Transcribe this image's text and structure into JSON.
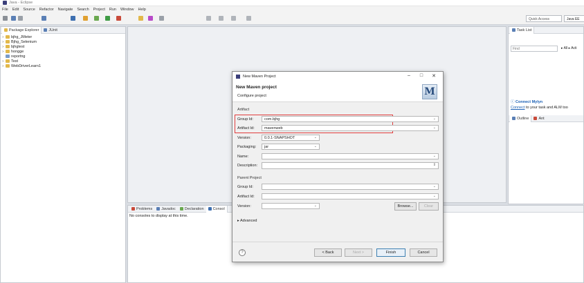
{
  "window": {
    "title": "Java - Eclipse"
  },
  "menu": [
    "File",
    "Edit",
    "Source",
    "Refactor",
    "Navigate",
    "Search",
    "Project",
    "Run",
    "Window",
    "Help"
  ],
  "toolbar": {
    "quick_access_placeholder": "Quick Access",
    "perspective_label": "Java EE"
  },
  "package_explorer": {
    "tabs": [
      "Package Explorer",
      "JUnit"
    ],
    "projects": [
      "bjhg_JMeter",
      "Bjhg_Selenium",
      "bjhgtest",
      "hongge",
      "reportng",
      "Test",
      "WebDriverLearn1"
    ]
  },
  "console": {
    "tabs": [
      "Problems",
      "Javadoc",
      "Declaration",
      "Consol"
    ],
    "message": "No consoles to display at this time."
  },
  "task_list": {
    "tab": "Task List",
    "find_placeholder": "Find",
    "filter_all": "All",
    "filter_acti": "Acti",
    "mylyn_title": "Connect Mylyn",
    "mylyn_link": "Connect",
    "mylyn_text": " to your task and ALM too"
  },
  "outline": {
    "tabs": [
      "Outline",
      "Ant"
    ]
  },
  "dialog": {
    "title": "New Maven Project",
    "heading": "New Maven project",
    "subheading": "Configure project",
    "artifact_section": "Artifact",
    "group_id_label": "Group Id:",
    "group_id_value": "com.bjhg",
    "artifact_id_label": "Artifact Id:",
    "artifact_id_value": "mavenweb",
    "version_label": "Version:",
    "version_value": "0.0.1-SNAPSHOT",
    "packaging_label": "Packaging:",
    "packaging_value": "jar",
    "name_label": "Name:",
    "description_label": "Description:",
    "parent_section": "Parent Project",
    "parent_group_label": "Group Id:",
    "parent_artifact_label": "Artifact Id:",
    "parent_version_label": "Version:",
    "browse": "Browse...",
    "clear": "Clear",
    "advanced": "Advanced",
    "back": "< Back",
    "next": "Next >",
    "finish": "Finish",
    "cancel": "Cancel",
    "help": "?"
  }
}
